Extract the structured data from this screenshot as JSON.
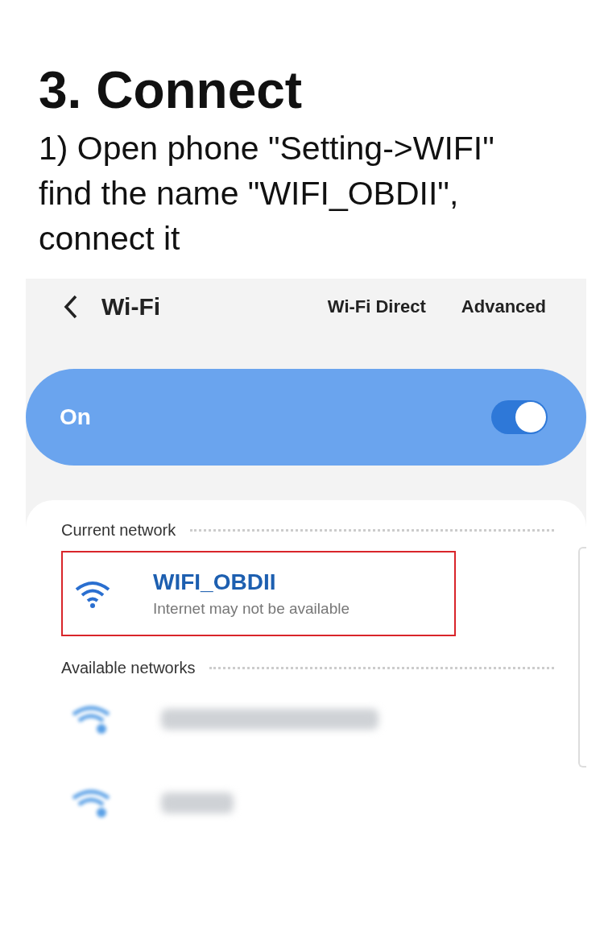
{
  "heading": "3. Connect",
  "instructions": [
    "1) Open phone \"Setting->WIFI\"",
    "find the name \"WIFI_OBDII\",",
    "connect it"
  ],
  "screen": {
    "title": "Wi-Fi",
    "header_links": [
      "Wi-Fi Direct",
      "Advanced"
    ],
    "wifi_switch": {
      "label": "On",
      "on": true
    },
    "current_network": {
      "section_label": "Current network",
      "name": "WIFI_OBDII",
      "status": "Internet may not be available",
      "highlighted": true
    },
    "available_networks": {
      "section_label": "Available networks",
      "networks": [
        {
          "kind": "blurred"
        },
        {
          "kind": "blurred"
        }
      ]
    }
  }
}
